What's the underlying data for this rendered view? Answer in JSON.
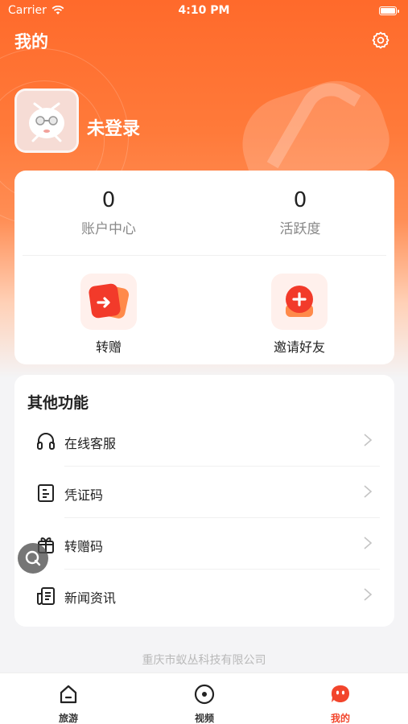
{
  "status_bar": {
    "carrier": "Carrier",
    "time": "4:10 PM"
  },
  "header": {
    "title": "我的",
    "settings_icon": "gear-icon"
  },
  "profile": {
    "login_status": "未登录",
    "avatar_icon": "mascot-avatar"
  },
  "stats": [
    {
      "value": "0",
      "label": "账户中心"
    },
    {
      "value": "0",
      "label": "活跃度"
    }
  ],
  "actions": [
    {
      "label": "转赠",
      "icon": "transfer-icon"
    },
    {
      "label": "邀请好友",
      "icon": "invite-friend-icon"
    }
  ],
  "functions": {
    "title": "其他功能",
    "items": [
      {
        "label": "在线客服",
        "icon": "headset-icon"
      },
      {
        "label": "凭证码",
        "icon": "voucher-icon"
      },
      {
        "label": "转赠码",
        "icon": "gift-icon"
      },
      {
        "label": "新闻资讯",
        "icon": "news-icon"
      }
    ]
  },
  "footer": {
    "company": "重庆市蚁丛科技有限公司"
  },
  "tabbar": {
    "active": "我的",
    "tabs": [
      {
        "label": "旅游",
        "icon": "home-icon"
      },
      {
        "label": "视频",
        "icon": "play-circle-icon"
      },
      {
        "label": "我的",
        "icon": "profile-face-icon"
      }
    ]
  },
  "colors": {
    "brand": "#ff6a2b",
    "accent_red": "#f2452c"
  }
}
